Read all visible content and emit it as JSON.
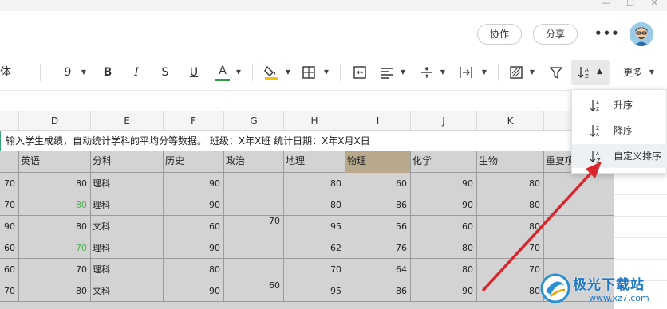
{
  "header": {
    "collab_label": "协作",
    "share_label": "分享",
    "more_dots": "•••"
  },
  "toolbar": {
    "font_name_fragment": "体",
    "font_size": "9",
    "bold_label": "B",
    "italic_label": "I",
    "strike_label": "S",
    "underline_label": "U",
    "font_color_label": "A",
    "more_label": "更多"
  },
  "columns": [
    "D",
    "E",
    "F",
    "G",
    "H",
    "I",
    "J",
    "K"
  ],
  "notice_text": "输入学生成绩，自动统计学科的平均分等数据。 班级：X年X班 统计日期：X年X月X日",
  "table": {
    "headers": [
      "英语",
      "分科",
      "历史",
      "政治",
      "地理",
      "物理",
      "化学",
      "生物",
      "重复项"
    ],
    "rows": [
      {
        "c0": "70",
        "en": "80",
        "fk": "理科",
        "ls": "90",
        "zz": "",
        "dl": "80",
        "wl": "60",
        "hx": "90",
        "sw": "80"
      },
      {
        "c0": "70",
        "en": "80",
        "fk": "理科",
        "ls": "90",
        "zz": "",
        "dl": "80",
        "wl": "86",
        "hx": "90",
        "sw": "80"
      },
      {
        "c0": "90",
        "en": "80",
        "fk": "文科",
        "ls": "60",
        "zz": "70",
        "dl": "95",
        "wl": "56",
        "hx": "60",
        "sw": "80"
      },
      {
        "c0": "60",
        "en": "70",
        "fk": "理科",
        "ls": "90",
        "zz": "",
        "dl": "62",
        "wl": "76",
        "hx": "80",
        "sw": "70"
      },
      {
        "c0": "60",
        "en": "70",
        "fk": "理科",
        "ls": "80",
        "zz": "",
        "dl": "70",
        "wl": "64",
        "hx": "80",
        "sw": "70"
      },
      {
        "c0": "70",
        "en": "80",
        "fk": "文科",
        "ls": "90",
        "zz": "60",
        "dl": "95",
        "wl": "86",
        "hx": "90",
        "sw": "80"
      }
    ],
    "green_text_color": "#4caf50",
    "highlight_header_color": "#b7a98a"
  },
  "dropdown": {
    "items": [
      {
        "label": "升序"
      },
      {
        "label": "降序"
      },
      {
        "label": "自定义排序"
      }
    ]
  },
  "watermark": {
    "brand": "极光下载站",
    "site": "www.xz7.com"
  },
  "colors": {
    "accent_green": "#3aa37a",
    "arrow_red": "#d9262c",
    "font_color_bar": "#2e9e44",
    "fill_color_bar": "#f5c400"
  }
}
